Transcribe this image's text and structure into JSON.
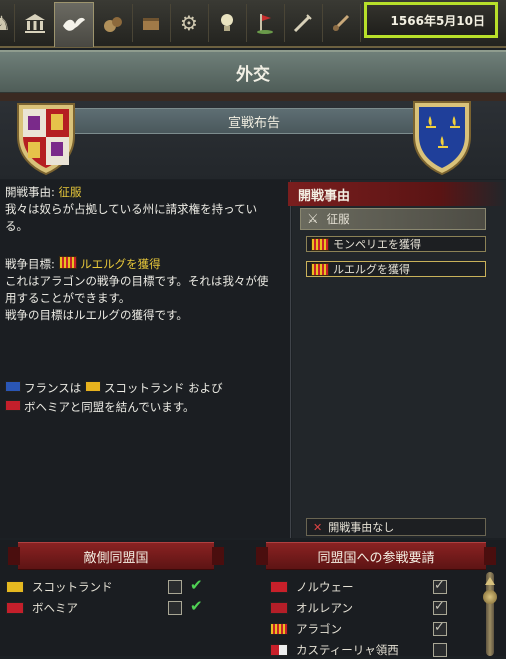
{
  "topbar": {
    "tabs": [
      {
        "icon": "court-icon"
      },
      {
        "icon": "diplomacy-dove-icon",
        "active": true
      },
      {
        "icon": "economy-icon"
      },
      {
        "icon": "trade-icon"
      },
      {
        "icon": "production-gear-icon"
      },
      {
        "icon": "ideas-lightbulb-icon"
      },
      {
        "icon": "missions-flag-icon"
      },
      {
        "icon": "military-icon"
      },
      {
        "icon": "missionaries-icon"
      }
    ],
    "date": "1566年5月10日",
    "date_highlight_color": "#b8e02a"
  },
  "title": "外交",
  "declare_war": {
    "header": "宣戦布告",
    "attacker_shield": "aragon-castile-shield",
    "defender_shield": "france-fleur-de-lis-shield"
  },
  "left_panel": {
    "cb_label": "開戦事由:",
    "cb_value": "征服",
    "cb_desc": "我々は奴らが占拠している州に請求権を持っている。",
    "goal_label": "戦争目標:",
    "goal_value": "ルエルグを獲得",
    "goal_desc": "これはアラゴンの戦争の目標です。それは我々が使用することができます。",
    "goal_desc2": "戦争の目標はルエルグの獲得です。",
    "alliance_part1": "フランスは",
    "alliance_part2": "スコットランド および",
    "alliance_part3": "ボヘミアと同盟を結んでいます。"
  },
  "right_panel": {
    "header": "開戦事由",
    "cb_item": "征服",
    "wargoals": [
      {
        "label": "モンペリエを獲得",
        "selected": false
      },
      {
        "label": "ルエルグを獲得",
        "selected": true
      }
    ],
    "no_cb": "開戦事由なし"
  },
  "bottom": {
    "enemy_header": "敵側同盟国",
    "call_header": "同盟国への参戦要請",
    "enemy_allies": [
      {
        "name": "スコットランド",
        "flag": "scotland-flag"
      },
      {
        "name": "ボヘミア",
        "flag": "bohemia-flag"
      }
    ],
    "call_allies": [
      {
        "name": "ノルウェー",
        "flag": "norway-flag"
      },
      {
        "name": "オルレアン",
        "flag": "orleans-flag"
      },
      {
        "name": "アラゴン",
        "flag": "aragon-flag"
      },
      {
        "name": "カスティーリャ領西",
        "flag": "castile-flag"
      }
    ]
  },
  "colors": {
    "ribbon_red": "#7a1e1e",
    "highlight_yellow": "#e8c83a",
    "check_green": "#4fd154"
  }
}
